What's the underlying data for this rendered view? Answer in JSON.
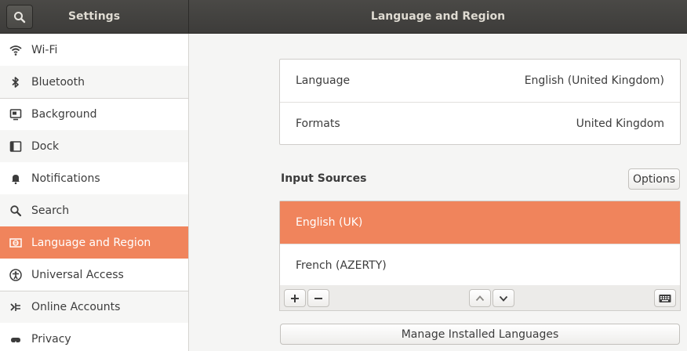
{
  "header": {
    "sidebar_title": "Settings",
    "page_title": "Language and Region"
  },
  "sidebar": {
    "items": [
      {
        "label": "Wi-Fi",
        "icon": "wifi-icon"
      },
      {
        "label": "Bluetooth",
        "icon": "bluetooth-icon"
      },
      {
        "label": "Background",
        "icon": "background-icon"
      },
      {
        "label": "Dock",
        "icon": "dock-icon"
      },
      {
        "label": "Notifications",
        "icon": "bell-icon"
      },
      {
        "label": "Search",
        "icon": "search-icon"
      },
      {
        "label": "Language and Region",
        "icon": "language-icon",
        "active": true
      },
      {
        "label": "Universal Access",
        "icon": "accessibility-icon"
      },
      {
        "label": "Online Accounts",
        "icon": "online-accounts-icon"
      },
      {
        "label": "Privacy",
        "icon": "privacy-icon"
      }
    ]
  },
  "language_card": {
    "language_label": "Language",
    "language_value": "English (United Kingdom)",
    "formats_label": "Formats",
    "formats_value": "United Kingdom"
  },
  "input_sources": {
    "title": "Input Sources",
    "options_label": "Options",
    "sources": [
      {
        "label": "English (UK)",
        "selected": true
      },
      {
        "label": "French (AZERTY)",
        "selected": false
      }
    ]
  },
  "manage_languages_label": "Manage Installed Languages",
  "colors": {
    "accent": "#f0845c",
    "header": "#3d3c3a"
  }
}
